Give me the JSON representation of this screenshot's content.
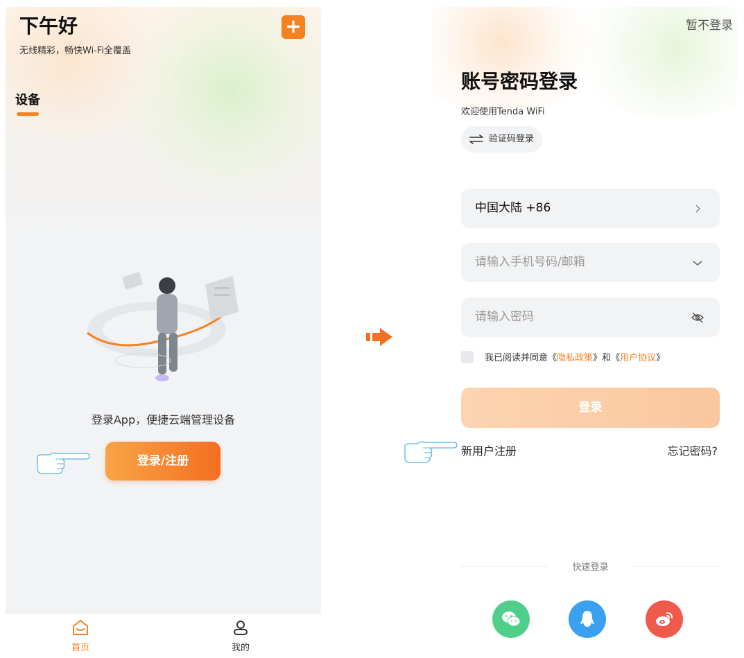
{
  "left_screen": {
    "greeting": "下午好",
    "subtitle": "无线精彩，畅快Wi-Fi全覆盖",
    "add_label": "+",
    "tab_devices": "设备",
    "promo_text": "登录App，便捷云端管理设备",
    "login_register_button": "登录/注册",
    "bottom_nav": [
      {
        "label": "首页",
        "icon": "home-icon",
        "active": true
      },
      {
        "label": "我的",
        "icon": "user-icon",
        "active": false
      }
    ],
    "colors": {
      "accent": "#f5811f",
      "button_gradient": [
        "#f9a446",
        "#f36f22"
      ]
    }
  },
  "right_screen": {
    "skip_login": "暂不登录",
    "title": "账号密码登录",
    "welcome": "欢迎使用Tenda WiFi",
    "code_login_button": "验证码登录",
    "region_field": "中国大陆 +86",
    "phone_placeholder": "请输入手机号码/邮箱",
    "password_placeholder": "请输入密码",
    "agreement": {
      "prefix": "我已阅读并同意",
      "privacy_open": "《",
      "privacy": "隐私政策",
      "privacy_close": "》",
      "and": "和",
      "terms_open": "《",
      "terms": "用户协议",
      "terms_close": "》"
    },
    "login_button": "登录",
    "register_link": "新用户注册",
    "forgot_link": "忘记密码?",
    "quick_login_label": "快速登录",
    "social_logins": [
      {
        "icon": "wechat-icon",
        "color": "#4fcf8a"
      },
      {
        "icon": "qq-icon",
        "color": "#3aa0f0"
      },
      {
        "icon": "weibo-icon",
        "color": "#f05a4a"
      }
    ]
  },
  "annotations": {
    "arrow_color": "#f36f22",
    "hand_color": "#5ab4e6"
  }
}
